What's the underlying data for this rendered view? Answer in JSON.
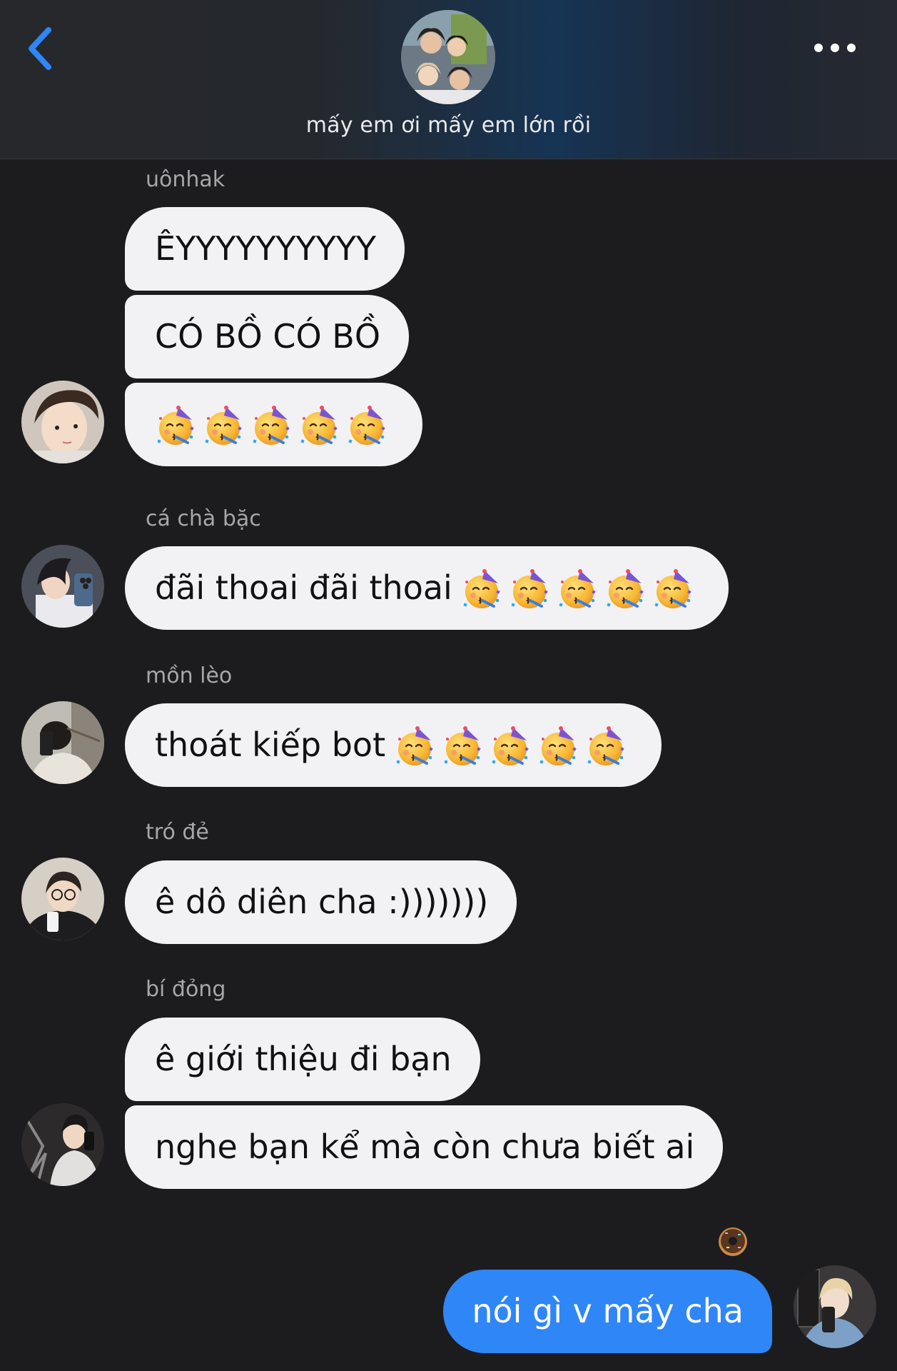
{
  "chat": {
    "title": "mấy em ơi mấy em lớn rồi"
  },
  "icons": {
    "back": "chevron-left-icon",
    "more": "more-horizontal-icon",
    "emoji": "partying-face-emoji",
    "reaction": "doughnut-emoji"
  },
  "colors": {
    "accent": "#2f86f6",
    "background": "#1c1c1e",
    "incoming_bubble": "#f2f2f4"
  },
  "groups": [
    {
      "sender": "uônhak",
      "messages": [
        {
          "text": "ÊYYYYYYYYYY",
          "emoji_count": 0
        },
        {
          "text": "CÓ BỒ CÓ BỒ",
          "emoji_count": 0
        },
        {
          "text": "",
          "emoji_count": 5
        }
      ]
    },
    {
      "sender": "cá chà bặc",
      "messages": [
        {
          "text": "đãi thoai đãi thoai",
          "emoji_count": 5
        }
      ]
    },
    {
      "sender": "mồn lèo",
      "messages": [
        {
          "text": "thoát kiếp bot",
          "emoji_count": 5
        }
      ]
    },
    {
      "sender": "tró đẻ",
      "messages": [
        {
          "text": "ê dô diên cha :)))))))",
          "emoji_count": 0
        }
      ]
    },
    {
      "sender": "bí đỏng",
      "messages": [
        {
          "text": "ê giới thiệu đi bạn",
          "emoji_count": 0
        },
        {
          "text": "nghe bạn kể mà còn chưa biết ai",
          "emoji_count": 0
        }
      ]
    }
  ],
  "outgoing": {
    "text": "nói gì v mấy cha",
    "reaction": "doughnut"
  }
}
